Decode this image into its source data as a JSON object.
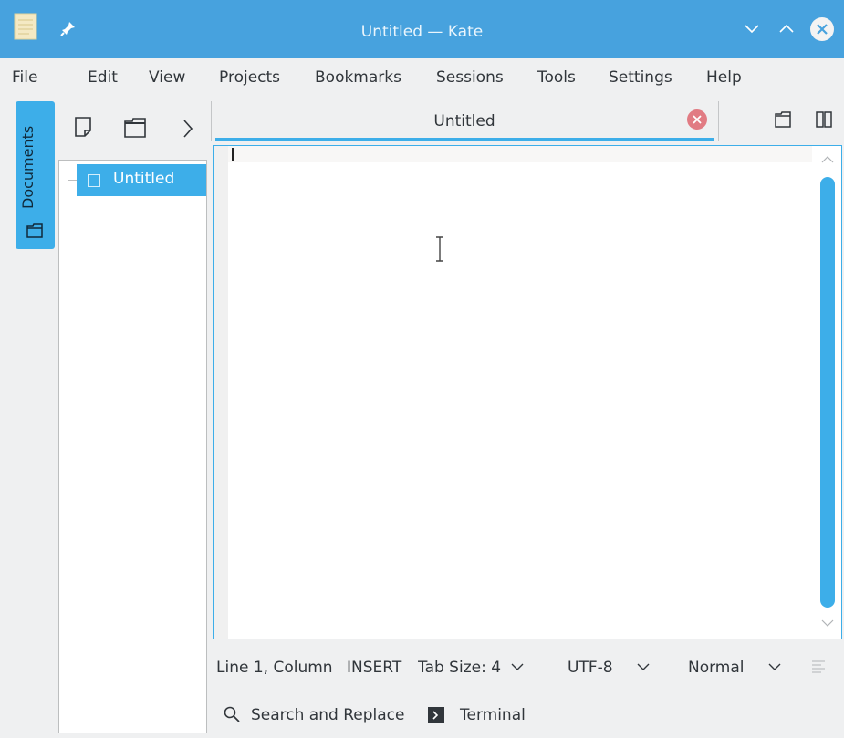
{
  "window": {
    "title": "Untitled  — Kate"
  },
  "menu": [
    "File",
    "Edit",
    "View",
    "Projects",
    "Bookmarks",
    "Sessions",
    "Tools",
    "Settings",
    "Help"
  ],
  "sidebar": {
    "tab_label": "Documents"
  },
  "documents": [
    {
      "name": "Untitled"
    }
  ],
  "tabs": [
    {
      "label": "Untitled"
    }
  ],
  "status": {
    "position": "Line 1, Column",
    "mode": "INSERT",
    "tab_size": "Tab Size: 4",
    "encoding": "UTF-8",
    "syntax": "Normal"
  },
  "bottom_tools": {
    "search": "Search and Replace",
    "terminal": "Terminal"
  },
  "colors": {
    "titlebar": "#47a2de",
    "accent": "#3daee9"
  }
}
